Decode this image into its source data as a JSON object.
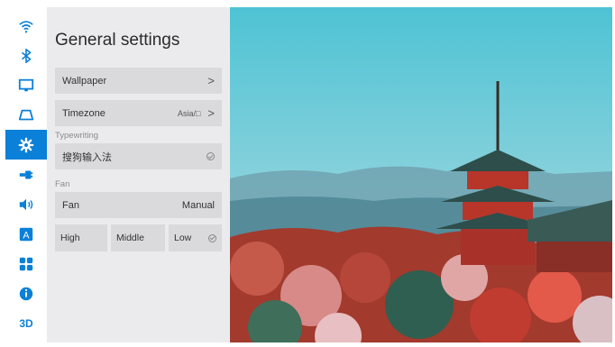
{
  "sidebar": {
    "icons": [
      {
        "name": "wifi-icon",
        "active": false
      },
      {
        "name": "bluetooth-icon",
        "active": false
      },
      {
        "name": "display-icon",
        "active": false
      },
      {
        "name": "projection-icon",
        "active": false
      },
      {
        "name": "gear-icon",
        "active": true
      },
      {
        "name": "input-source-icon",
        "active": false
      },
      {
        "name": "volume-icon",
        "active": false
      },
      {
        "name": "language-icon",
        "label": "A",
        "active": false
      },
      {
        "name": "apps-grid-icon",
        "active": false
      },
      {
        "name": "info-icon",
        "active": false
      },
      {
        "name": "3d-icon",
        "label": "3D",
        "active": false
      }
    ],
    "accent_color": "#0b80d8"
  },
  "panel": {
    "title": "General settings",
    "wallpaper": {
      "label": "Wallpaper",
      "chevron": ">"
    },
    "timezone": {
      "label": "Timezone",
      "value": "Asia/□",
      "chevron": ">"
    },
    "typewriting": {
      "section": "Typewriting",
      "selected": "搜狗输入法"
    },
    "fan": {
      "section": "Fan",
      "label": "Fan",
      "mode": "Manual",
      "speeds": [
        "High",
        "Middle",
        "Low"
      ],
      "selected_speed": "Low"
    }
  }
}
